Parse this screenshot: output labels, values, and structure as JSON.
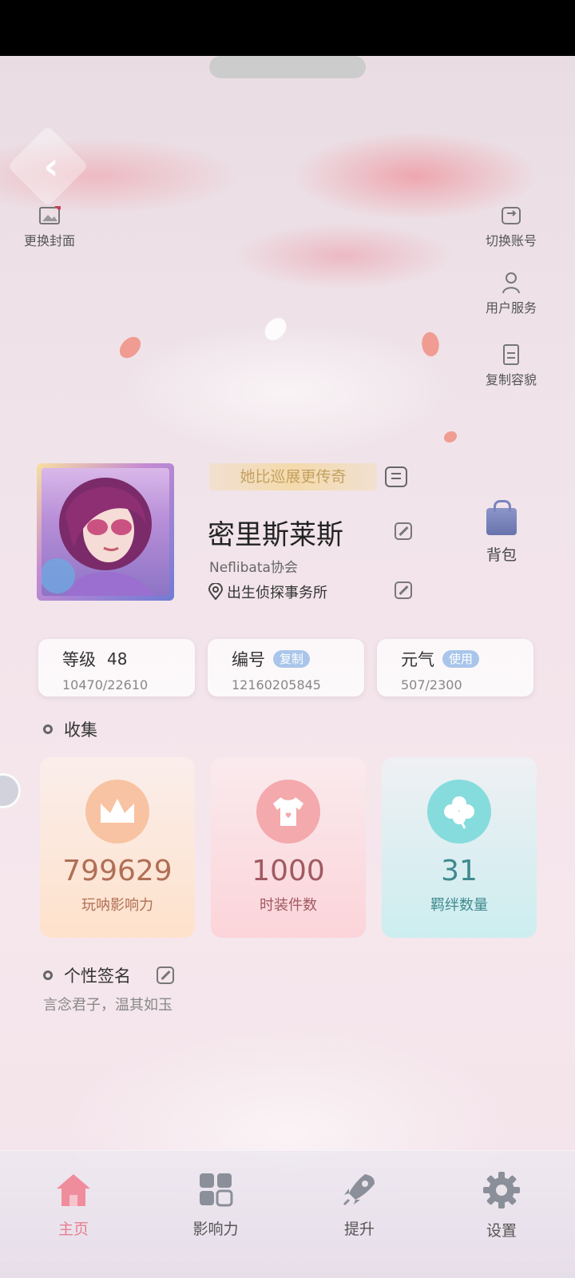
{
  "cover": {
    "change_cover_label": "更换封面"
  },
  "side_actions": {
    "switch_account_label": "切换账号",
    "user_service_label": "用户服务",
    "copy_outfit_label": "复制容貌"
  },
  "profile": {
    "title_tag": "她比巡展更传奇",
    "name": "密里斯莱斯",
    "guild": "Neflibata协会",
    "location": "出生侦探事务所",
    "bag_label": "背包"
  },
  "stats": {
    "level": {
      "label": "等级",
      "value": "48",
      "progress": "10470/22610"
    },
    "id": {
      "label": "编号",
      "chip": "复制",
      "value": "12160205845"
    },
    "energy": {
      "label": "元气",
      "chip": "使用",
      "value": "507/2300"
    }
  },
  "collection": {
    "title": "收集",
    "cards": [
      {
        "value": "799629",
        "label": "玩呐影响力",
        "icon": "crown-icon"
      },
      {
        "value": "1000",
        "label": "时装件数",
        "icon": "tshirt-icon"
      },
      {
        "value": "31",
        "label": "羁绊数量",
        "icon": "clover-icon"
      }
    ]
  },
  "signature": {
    "title": "个性签名",
    "text": "言念君子，温其如玉"
  },
  "tabs": [
    {
      "label": "主页",
      "icon": "home-icon",
      "active": true
    },
    {
      "label": "影响力",
      "icon": "grid-icon",
      "active": false
    },
    {
      "label": "提升",
      "icon": "rocket-icon",
      "active": false
    },
    {
      "label": "设置",
      "icon": "gear-icon",
      "active": false
    }
  ],
  "colors": {
    "accent_pink": "#e87f93",
    "chip_blue": "#a9c6ea",
    "card_orange": "#b06f55",
    "card_pink": "#a05a62",
    "card_teal": "#3f8a8e"
  }
}
